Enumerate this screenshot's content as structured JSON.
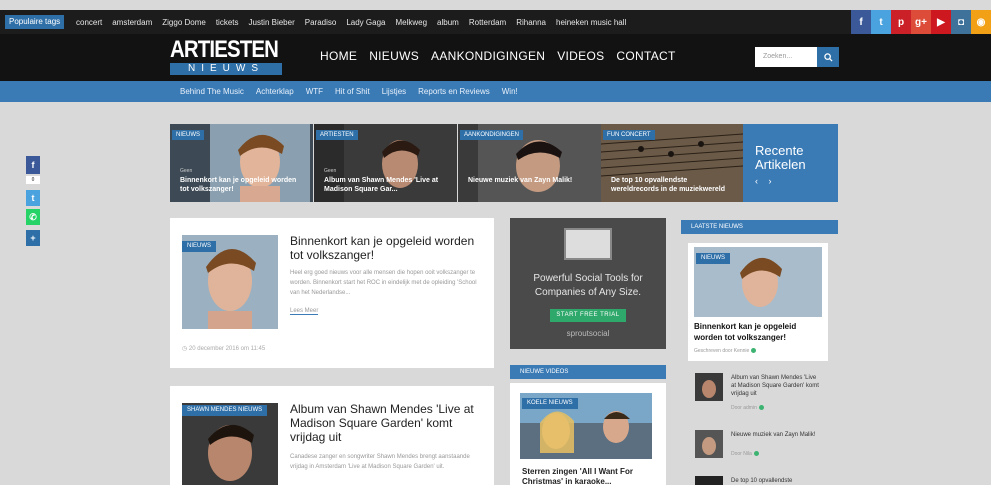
{
  "topbar": {
    "tags_label": "Populaire tags",
    "tags": [
      "concert",
      "amsterdam",
      "Ziggo Dome",
      "tickets",
      "Justin Bieber",
      "Paradiso",
      "Lady Gaga",
      "Melkweg",
      "album",
      "Rotterdam",
      "Rihanna",
      "heineken music hall"
    ],
    "social": [
      {
        "icon": "facebook-icon",
        "glyph": "f",
        "color": "#3b5998"
      },
      {
        "icon": "twitter-icon",
        "glyph": "t",
        "color": "#4aa3df"
      },
      {
        "icon": "pinterest-icon",
        "glyph": "p",
        "color": "#cb2027"
      },
      {
        "icon": "google-plus-icon",
        "glyph": "g+",
        "color": "#dd4b39"
      },
      {
        "icon": "youtube-icon",
        "glyph": "▶",
        "color": "#cc181e"
      },
      {
        "icon": "instagram-icon",
        "glyph": "◘",
        "color": "#3f729b"
      },
      {
        "icon": "rss-icon",
        "glyph": "◉",
        "color": "#f2a117"
      }
    ]
  },
  "header": {
    "logo_top": "ARTIESTEN",
    "logo_bottom": "NIEUWS",
    "nav": [
      "HOME",
      "NIEUWS",
      "AANKONDIGINGEN",
      "VIDEOS",
      "CONTACT"
    ],
    "search_placeholder": "Zoeken..."
  },
  "subnav": [
    "Behind The Music",
    "Achterklap",
    "WTF",
    "Hit of Shit",
    "Lijstjes",
    "Reports en Reviews",
    "Win!"
  ],
  "slider": [
    {
      "cat": "NIEUWS",
      "date": "Geen",
      "title": "Binnenkort kan je opgeleid worden tot volkszanger!"
    },
    {
      "cat": "ARTIESTEN",
      "date": "Geen",
      "title": "Album van Shawn Mendes 'Live at Madison Square Gar..."
    },
    {
      "cat": "AANKONDIGINGEN",
      "date": "",
      "title": "Nieuwe muziek van Zayn Malik!"
    },
    {
      "cat": "FUN CONCERT",
      "date": "",
      "title": "De top 10 opvallendste wereldrecords in de muziekwereld"
    }
  ],
  "recent": {
    "title": "Recente Artikelen",
    "arrows": "‹ ›"
  },
  "main_article": {
    "badge": "NIEUWS",
    "title": "Binnenkort kan je opgeleid worden tot volkszanger!",
    "excerpt": "Heel erg goed nieuws voor alle mensen die hopen ooit volkszanger te worden. Binnenkort start het ROC in eindelijk met de opleiding 'School van het Nederlandse...",
    "read_more": "Lees Meer",
    "date": "20 december 2016 om 11:45"
  },
  "second_article": {
    "badge": "SHAWN MENDES NIEUWS",
    "title": "Album van Shawn Mendes 'Live at Madison Square Garden' komt vrijdag uit",
    "excerpt": "Canadese zanger en songwriter Shawn Mendes brengt aanstaande vrijdag in Amsterdam 'Live at Madison Square Garden' uit."
  },
  "ad": {
    "text": "Powerful Social Tools for Companies of Any Size.",
    "button": "START FREE TRIAL",
    "brand": "sproutsocial"
  },
  "videos": {
    "section": "NIEUWE VIDEOS",
    "badge": "KOELE NIEUWS",
    "title": "Sterren zingen 'All I Want For Christmas' in karaoke..."
  },
  "latest": {
    "section": "LAATSTE NIEUWS",
    "featured_badge": "NIEUWS",
    "featured_title": "Binnenkort kan je opgeleid worden tot volkszanger!",
    "featured_by": "Geschreven door Kennie",
    "items": [
      {
        "title": "Album van Shawn Mendes 'Live at Madison Square Garden' komt vrijdag uit",
        "by": "Door admin"
      },
      {
        "title": "Nieuwe muziek van Zayn Malik!",
        "by": "Door Nila"
      },
      {
        "title": "De top 10 opvallendste",
        "by": ""
      }
    ]
  },
  "share": [
    {
      "icon": "facebook-share-icon",
      "glyph": "f",
      "color": "#3b5998"
    },
    {
      "icon": "twitter-share-icon",
      "glyph": "t",
      "color": "#4aa3df"
    },
    {
      "icon": "whatsapp-share-icon",
      "glyph": "✆",
      "color": "#25d366"
    },
    {
      "icon": "more-share-icon",
      "glyph": "+",
      "color": "#2e6fa8"
    }
  ]
}
